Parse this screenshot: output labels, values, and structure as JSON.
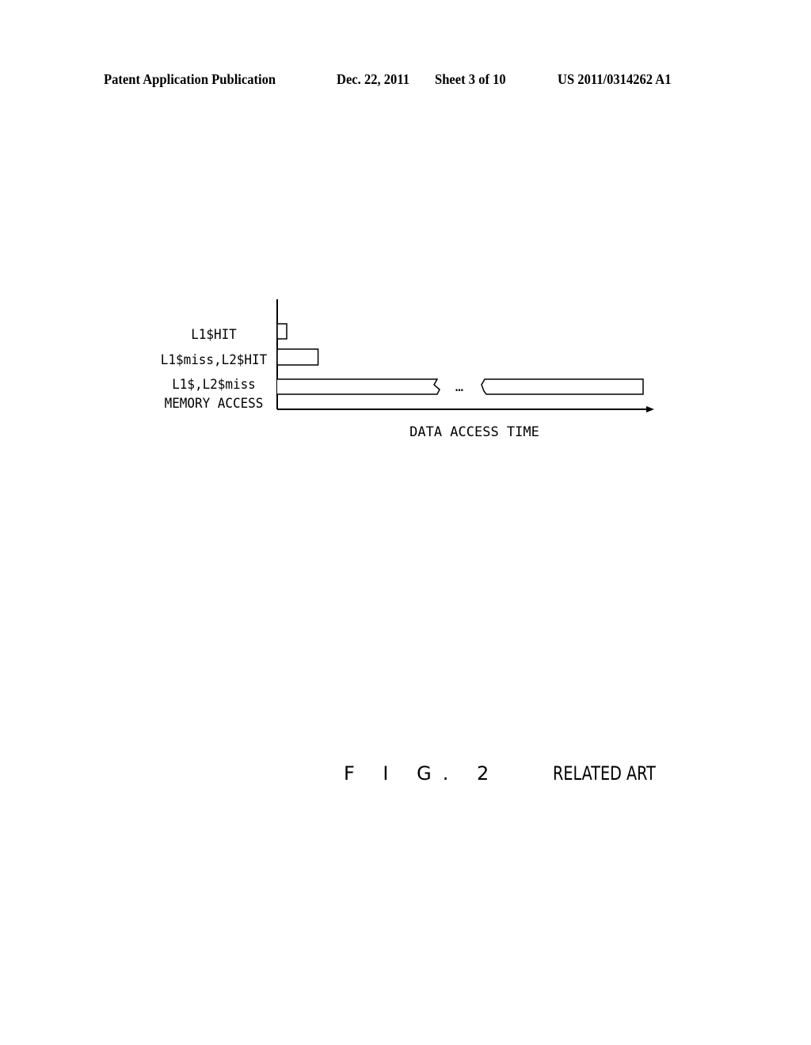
{
  "header": {
    "publication": "Patent Application Publication",
    "date": "Dec. 22, 2011",
    "sheet": "Sheet 3 of 10",
    "number": "US 2011/0314262 A1"
  },
  "figure": {
    "label": "F I G. 2",
    "note": "RELATED ART"
  },
  "chart_data": {
    "type": "bar",
    "orientation": "horizontal",
    "title": "",
    "xlabel": "DATA ACCESS TIME",
    "ylabel": "",
    "categories": [
      "L1$HIT",
      "L1$miss,L2$HIT",
      "L1$,L2$miss MEMORY ACCESS"
    ],
    "category_lines": [
      [
        "L1$HIT"
      ],
      [
        "L1$miss,L2$HIT"
      ],
      [
        "L1$,L2$miss",
        "MEMORY ACCESS"
      ]
    ],
    "values": [
      1,
      4.3,
      38.5
    ],
    "value_units": "relative (no scale shown)",
    "broken_bars": [
      false,
      false,
      true
    ],
    "break_marker": "…",
    "xlim": [
      0,
      39.5
    ],
    "grid": false,
    "legend": "none"
  }
}
